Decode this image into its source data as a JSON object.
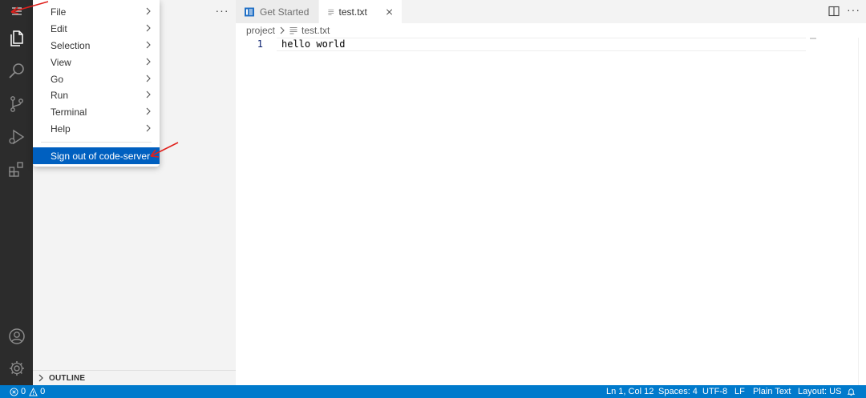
{
  "menu": {
    "items": [
      {
        "label": "File"
      },
      {
        "label": "Edit"
      },
      {
        "label": "Selection"
      },
      {
        "label": "View"
      },
      {
        "label": "Go"
      },
      {
        "label": "Run"
      },
      {
        "label": "Terminal"
      },
      {
        "label": "Help"
      }
    ],
    "sign_out_label": "Sign out of code-server"
  },
  "sidebar": {
    "more_label": "···",
    "outline_label": "OUTLINE"
  },
  "tabs": [
    {
      "label": "Get Started",
      "icon": "get-started-icon",
      "active": false
    },
    {
      "label": "test.txt",
      "icon": "file-lines-icon",
      "active": true
    }
  ],
  "breadcrumb": {
    "folder": "project",
    "file": "test.txt"
  },
  "editor": {
    "line_number": "1",
    "line_text": "hello world"
  },
  "statusbar": {
    "errors": "0",
    "warnings": "0",
    "position": "Ln 1, Col 12",
    "spaces": "Spaces: 4",
    "encoding": "UTF-8",
    "eol": "LF",
    "language": "Plain Text",
    "layout": "Layout: US"
  },
  "colors": {
    "activity_bar": "#2c2c2c",
    "statusbar": "#007acc",
    "menu_selection": "#0060c0",
    "annotation_arrow": "#e0201c"
  }
}
